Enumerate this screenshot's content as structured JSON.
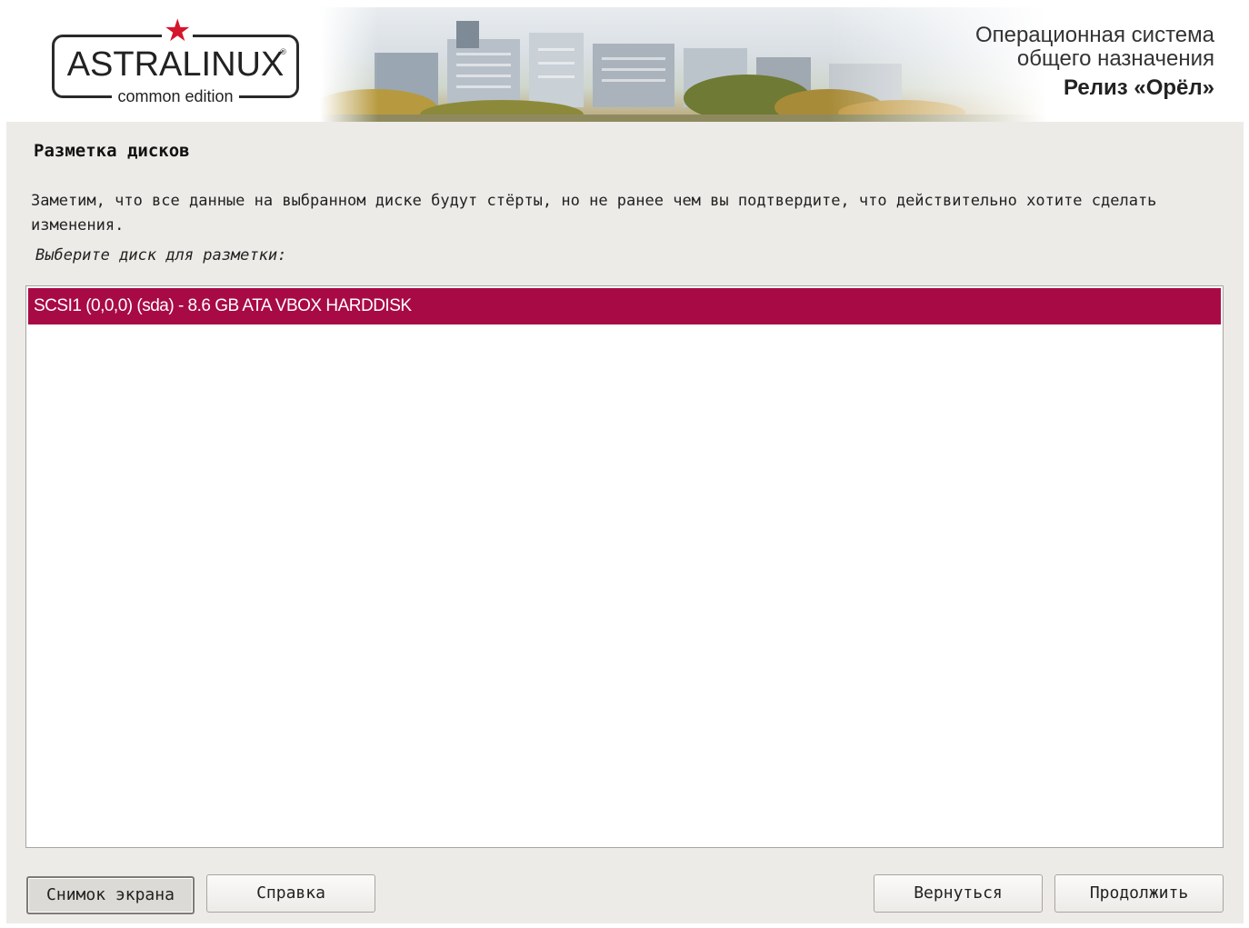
{
  "header": {
    "logo_text": "ASTRALINUX",
    "logo_subtitle": "common edition",
    "tagline_line1": "Операционная система",
    "tagline_line2": "общего назначения",
    "release": "Релиз «Орёл»"
  },
  "page": {
    "title": "Разметка дисков",
    "description": "Заметим, что все данные на выбранном диске будут стёрты, но не ранее чем вы подтвердите, что действительно хотите сделать изменения.",
    "prompt": "Выберите диск для разметки:"
  },
  "disk_list": {
    "items": [
      {
        "label": "SCSI1 (0,0,0) (sda) - 8.6 GB ATA VBOX HARDDISK",
        "selected": true
      }
    ]
  },
  "buttons": {
    "screenshot": "Снимок экрана",
    "help": "Справка",
    "back": "Вернуться",
    "continue": "Продолжить"
  },
  "colors": {
    "selection": "#a80a46",
    "logo_star": "#d4152b",
    "background": "#edebe8"
  },
  "icons": {
    "logo_star": "red-star-icon"
  }
}
